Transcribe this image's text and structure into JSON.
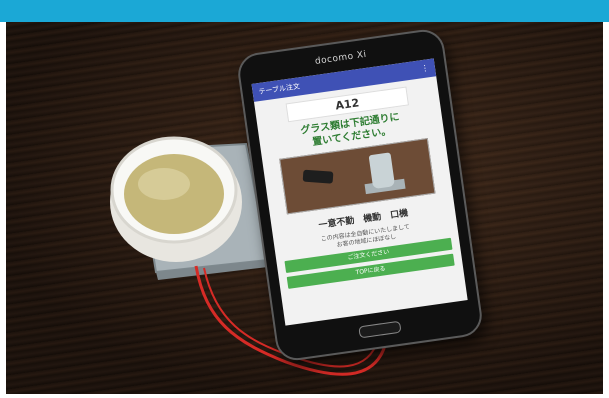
{
  "colors": {
    "top_bar": "#1ba8d6",
    "cable": "#d62b26",
    "app_accent": "#3f51b5",
    "button_green": "#4caf50"
  },
  "phone": {
    "brand": "docomo Xi"
  },
  "app": {
    "title": "テーブル注文",
    "menu_icon": "overflow-menu-icon",
    "table_id": "A12",
    "instruction_line1": "グラス類は下記通りに",
    "instruction_line2": "置いてください。",
    "status_row": "一意不勤  機動  口機",
    "note_line1": "この内容は全自動にいたしまして",
    "note_line2": "お客の地域にほぼなし",
    "button_primary": "ご注文ください",
    "button_secondary": "TOPに戻る"
  }
}
